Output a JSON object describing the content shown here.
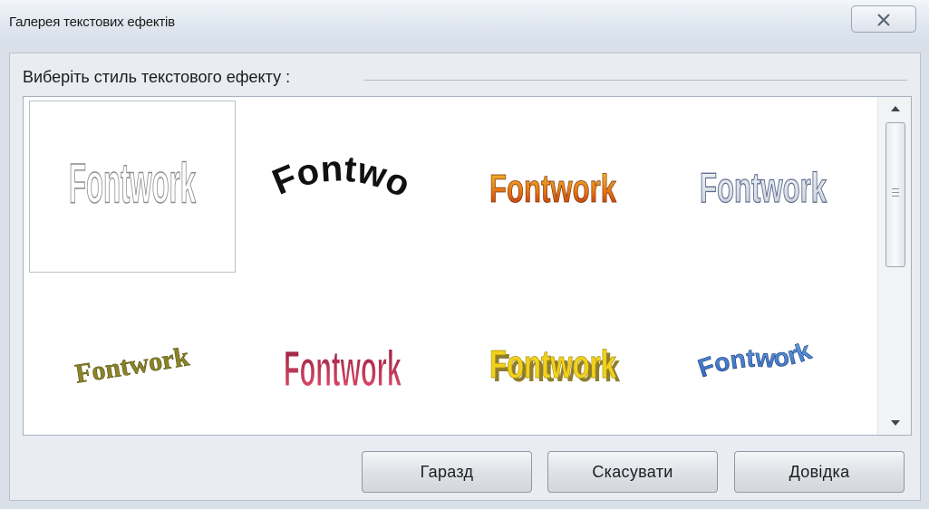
{
  "window": {
    "title": "Галерея текстових ефектів",
    "close_label": "Close"
  },
  "gallery": {
    "group_label": "Виберіть стиль текстового ефекту :",
    "items": [
      {
        "text": "Fontwork",
        "style": "outline-gray",
        "selected": true
      },
      {
        "text": "Fontwork",
        "style": "black-arch"
      },
      {
        "text": "Fontwork",
        "style": "orange-fire"
      },
      {
        "text": "Fontwork",
        "style": "silver-outline"
      },
      {
        "text": "Fontwork",
        "style": "olive-slant"
      },
      {
        "text": "Fontwork",
        "style": "pink-perspective"
      },
      {
        "text": "Fontwork",
        "style": "yellow-3d"
      },
      {
        "text": "Fontwork",
        "style": "blue-wave"
      }
    ]
  },
  "buttons": {
    "ok": "Гаразд",
    "cancel": "Скасувати",
    "help": "Довідка"
  },
  "colors": {
    "window_bg": "#d9e0ea",
    "gallery_bg": "#ffffff",
    "accent_orange": "#e07b12",
    "accent_yellow": "#f2d21a",
    "accent_blue": "#3f7fd1",
    "accent_pink": "#d8385f",
    "accent_olive": "#7f7a1c"
  }
}
